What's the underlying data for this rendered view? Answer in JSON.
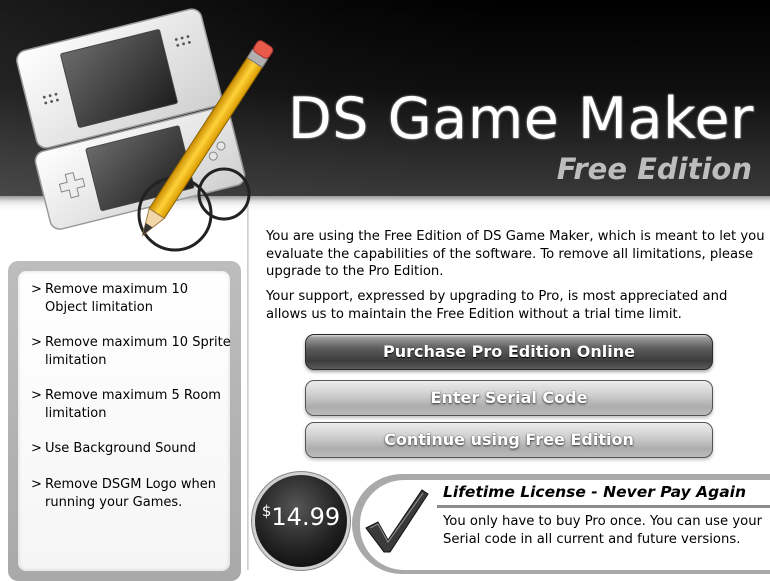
{
  "header": {
    "title": "DS Game Maker",
    "subtitle": "Free Edition"
  },
  "features": [
    {
      "arrow": ">",
      "text": "Remove maximum 10 Object limitation"
    },
    {
      "arrow": ">",
      "text": "Remove maximum 10 Sprite limitation"
    },
    {
      "arrow": ">",
      "text": "Remove maximum 5 Room limitation"
    },
    {
      "arrow": ">",
      "text": "Use Background Sound"
    },
    {
      "arrow": ">",
      "text": "Remove DSGM Logo when running your Games."
    }
  ],
  "intro": {
    "paragraph1": "You are using the Free Edition of DS Game Maker, which is meant to let you evaluate the capabilities of the software. To remove all limitations, please upgrade to the Pro Edition.",
    "paragraph2": "Your support, expressed by upgrading to Pro, is most appreciated and allows us to maintain the Free Edition without a trial time limit."
  },
  "buttons": {
    "purchase": "Purchase Pro Edition Online",
    "serial": "Enter Serial Code",
    "continue": "Continue using Free Edition"
  },
  "license": {
    "currency": "$",
    "price": "14.99",
    "title": "Lifetime License - Never Pay Again",
    "text": "You only have to buy Pro once. You can use your Serial code in all current and future versions."
  },
  "icons": {
    "illustration": "nintendo-ds-with-pencil-icon",
    "check": "checkmark-icon"
  }
}
